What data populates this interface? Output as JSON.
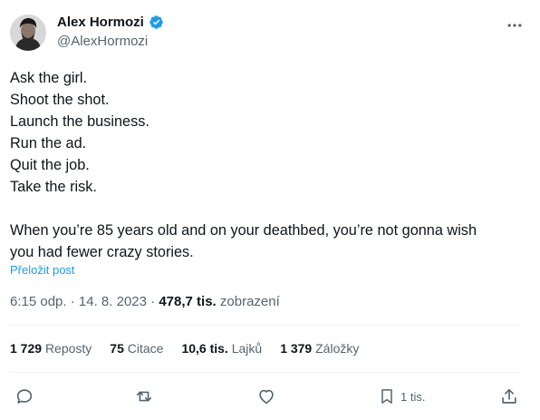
{
  "author": {
    "name": "Alex Hormozi",
    "handle": "@AlexHormozi",
    "verified_icon": "verified-badge-icon"
  },
  "tweet": {
    "lines": [
      "Ask the girl.",
      "Shoot the shot.",
      "Launch the business.",
      "Run the ad.",
      "Quit the job.",
      "Take the risk.",
      "",
      "When you’re 85 years old and on your deathbed, you’re not gonna wish",
      "you had fewer crazy stories."
    ],
    "translate_label": "Přeložit post"
  },
  "meta": {
    "time": "6:15 odp.",
    "separator": "·",
    "date": "14. 8. 2023",
    "views_count": "478,7 tis.",
    "views_label": "zobrazení"
  },
  "stats": {
    "reposts": {
      "count": "1 729",
      "label": "Reposty"
    },
    "quotes": {
      "count": "75",
      "label": "Citace"
    },
    "likes": {
      "count": "10,6 tis.",
      "label": "Lajků"
    },
    "bookmarks": {
      "count": "1 379",
      "label": "Záložky"
    }
  },
  "actions": {
    "bookmark_count": "1 tis."
  },
  "colors": {
    "accent": "#1d9bf0",
    "text": "#0f1419",
    "secondary": "#536471",
    "divider": "#eff3f4"
  }
}
